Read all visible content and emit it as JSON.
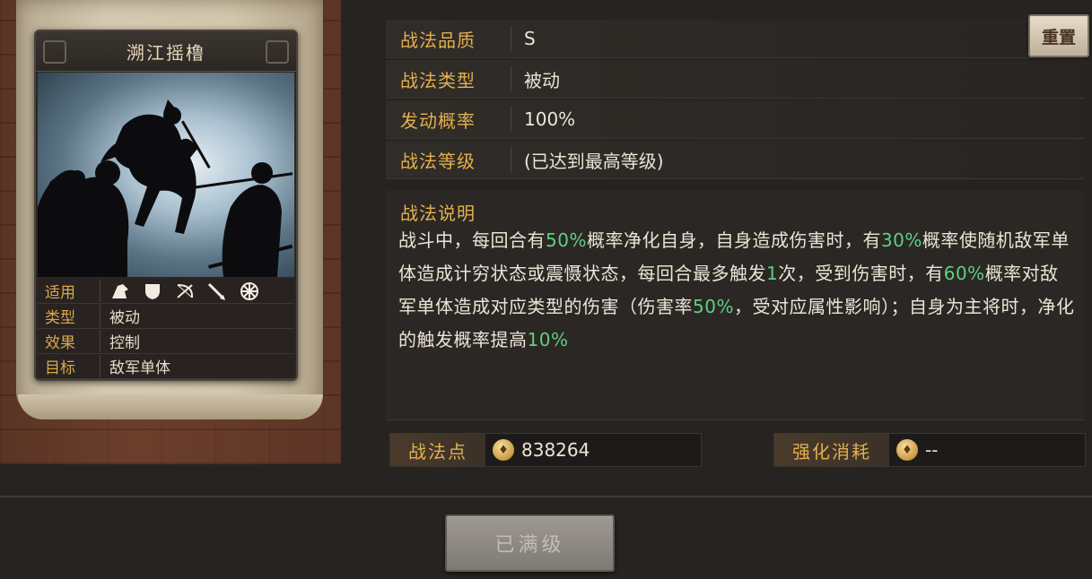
{
  "skill_card": {
    "name": "溯江摇橹",
    "rows": [
      {
        "label": "适用",
        "value": ""
      },
      {
        "label": "类型",
        "value": "被动"
      },
      {
        "label": "效果",
        "value": "控制"
      },
      {
        "label": "目标",
        "value": "敌军单体"
      }
    ],
    "troop_icons": [
      "cavalry-icon",
      "shield-icon",
      "bow-icon",
      "spear-icon",
      "wheel-icon"
    ]
  },
  "details": {
    "quality": {
      "label": "战法品质",
      "value": "S"
    },
    "type": {
      "label": "战法类型",
      "value": "被动"
    },
    "rate": {
      "label": "发动概率",
      "value": "100%"
    },
    "level": {
      "label": "战法等级",
      "value": "(已达到最高等级)"
    }
  },
  "description": {
    "label": "战法说明",
    "segments": [
      {
        "t": "战斗中，每回合有",
        "hl": false
      },
      {
        "t": "50%",
        "hl": true
      },
      {
        "t": "概率净化自身，自身造成伤害时，有",
        "hl": false
      },
      {
        "t": "30%",
        "hl": true
      },
      {
        "t": "概率使随机敌军单体造成计穷状态或震慑状态，每回合最多触发",
        "hl": false
      },
      {
        "t": "1",
        "hl": true
      },
      {
        "t": "次，受到伤害时，有",
        "hl": false
      },
      {
        "t": "60%",
        "hl": true
      },
      {
        "t": "概率对敌军单体造成对应类型的伤害（伤害率",
        "hl": false
      },
      {
        "t": "50%",
        "hl": true
      },
      {
        "t": "，受对应属性影响）；自身为主将时，净化的触发概率提高",
        "hl": false
      },
      {
        "t": "10%",
        "hl": true
      }
    ]
  },
  "points": {
    "label": "战法点",
    "value": "838264"
  },
  "cost": {
    "label": "强化消耗",
    "value": "--"
  },
  "buttons": {
    "reset": "重置",
    "maxed": "已满级"
  },
  "colors": {
    "gold": "#e3b04f",
    "highlight": "#5fcf82"
  }
}
